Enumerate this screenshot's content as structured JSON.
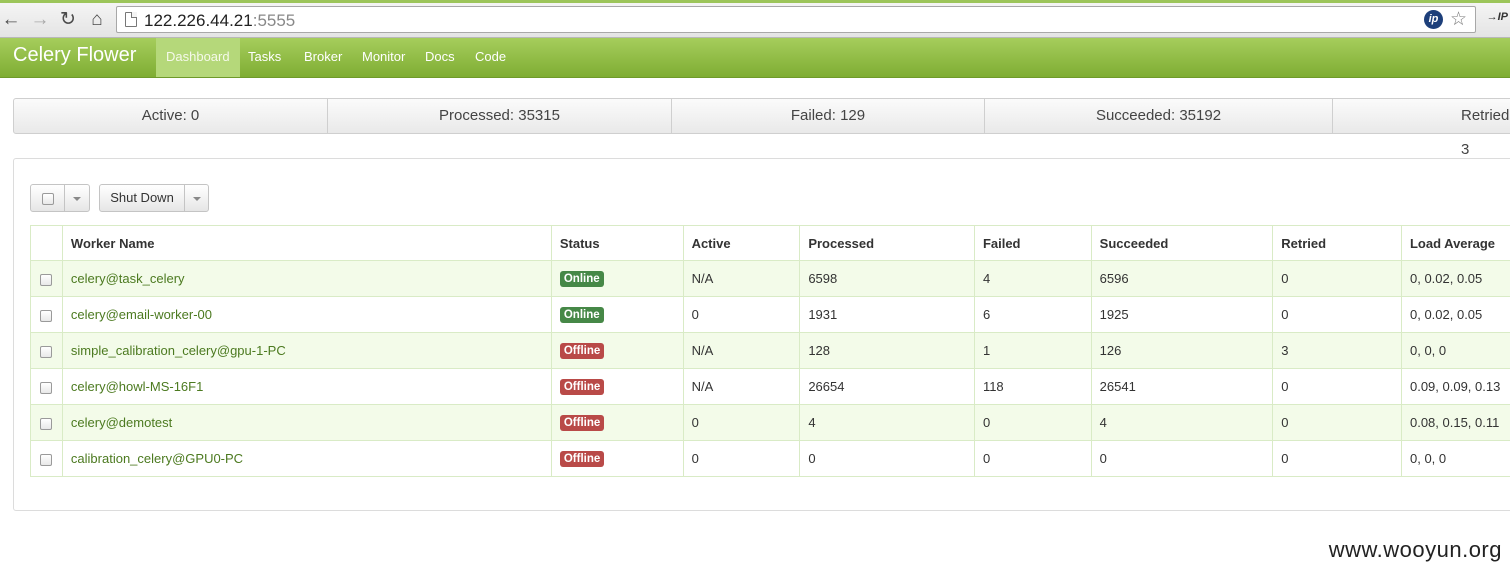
{
  "browser": {
    "url_host": "122.226.44.21",
    "url_port": ":5555",
    "ext_label": "IP"
  },
  "navbar": {
    "brand": "Celery Flower",
    "items": [
      {
        "label": "Dashboard",
        "active": true
      },
      {
        "label": "Tasks"
      },
      {
        "label": "Broker"
      },
      {
        "label": "Monitor"
      },
      {
        "label": "Docs"
      },
      {
        "label": "Code"
      }
    ]
  },
  "stats": [
    {
      "label": "Active: 0"
    },
    {
      "label": "Processed: 35315"
    },
    {
      "label": "Failed: 129"
    },
    {
      "label": "Succeeded: 35192"
    },
    {
      "label": "Retried: 3"
    }
  ],
  "toolbar": {
    "shutdown_label": "Shut Down"
  },
  "table": {
    "headers": [
      "Worker Name",
      "Status",
      "Active",
      "Processed",
      "Failed",
      "Succeeded",
      "Retried",
      "Load Average"
    ],
    "rows": [
      {
        "name": "celery@task_celery",
        "status": "Online",
        "active": "N/A",
        "processed": "6598",
        "failed": "4",
        "succeeded": "6596",
        "retried": "0",
        "load": "0, 0.02, 0.05"
      },
      {
        "name": "celery@email-worker-00",
        "status": "Online",
        "active": "0",
        "processed": "1931",
        "failed": "6",
        "succeeded": "1925",
        "retried": "0",
        "load": "0, 0.02, 0.05"
      },
      {
        "name": "simple_calibration_celery@gpu-1-PC",
        "status": "Offline",
        "active": "N/A",
        "processed": "128",
        "failed": "1",
        "succeeded": "126",
        "retried": "3",
        "load": "0, 0, 0"
      },
      {
        "name": "celery@howl-MS-16F1",
        "status": "Offline",
        "active": "N/A",
        "processed": "26654",
        "failed": "118",
        "succeeded": "26541",
        "retried": "0",
        "load": "0.09, 0.09, 0.13"
      },
      {
        "name": "celery@demotest",
        "status": "Offline",
        "active": "0",
        "processed": "4",
        "failed": "0",
        "succeeded": "4",
        "retried": "0",
        "load": "0.08, 0.15, 0.11"
      },
      {
        "name": "calibration_celery@GPU0-PC",
        "status": "Offline",
        "active": "0",
        "processed": "0",
        "failed": "0",
        "succeeded": "0",
        "retried": "0",
        "load": "0, 0, 0"
      }
    ]
  },
  "colors": {
    "navbar_top": "#a6cd5c",
    "navbar_bottom": "#7fad33",
    "online": "#468847",
    "offline": "#b94a48",
    "link_green": "#4c7a20"
  },
  "watermark": "www.wooyun.org"
}
